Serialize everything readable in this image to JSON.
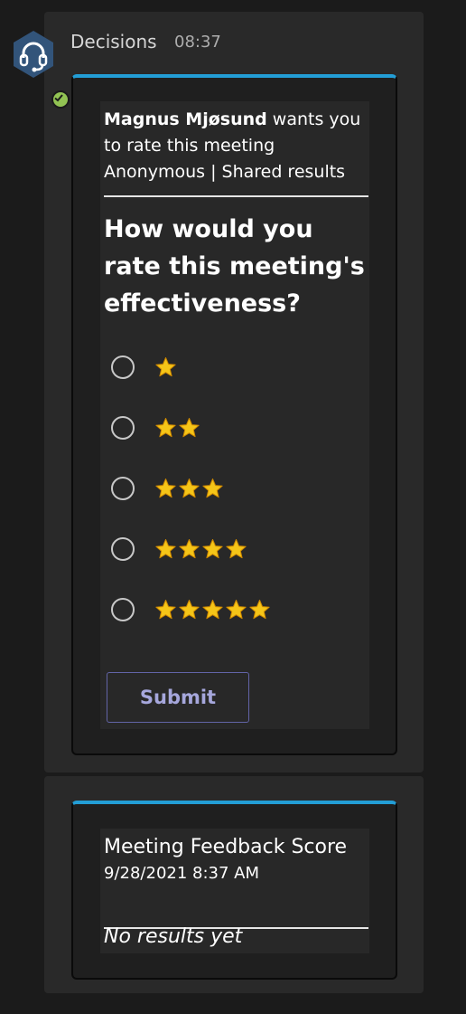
{
  "message": {
    "sender": "Decisions",
    "time": "08:37",
    "avatar_icon": "headset-icon",
    "presence_icon": "checkmark-icon",
    "presence_color": "#92c353"
  },
  "poll_card": {
    "requester_name": "Magnus Mjøsund",
    "requester_text": " wants you to rate this meeting",
    "mode": "Anonymous | Shared results",
    "question": "How would you rate this meeting's effectiveness?",
    "options": [
      {
        "stars": 1,
        "selected": false
      },
      {
        "stars": 2,
        "selected": false
      },
      {
        "stars": 3,
        "selected": false
      },
      {
        "stars": 4,
        "selected": false
      },
      {
        "stars": 5,
        "selected": false
      }
    ],
    "submit_label": "Submit",
    "accent_color": "#239ed6"
  },
  "results_card": {
    "title": "Meeting Feedback Score",
    "date": "9/28/2021 8:37 AM",
    "status": "No results yet"
  },
  "colors": {
    "background": "#1b1b1b",
    "panel": "#292929",
    "card_accent": "#239ed6",
    "button_border": "#6264a7",
    "button_text": "#a6a7dc",
    "star": "#f5c518"
  }
}
